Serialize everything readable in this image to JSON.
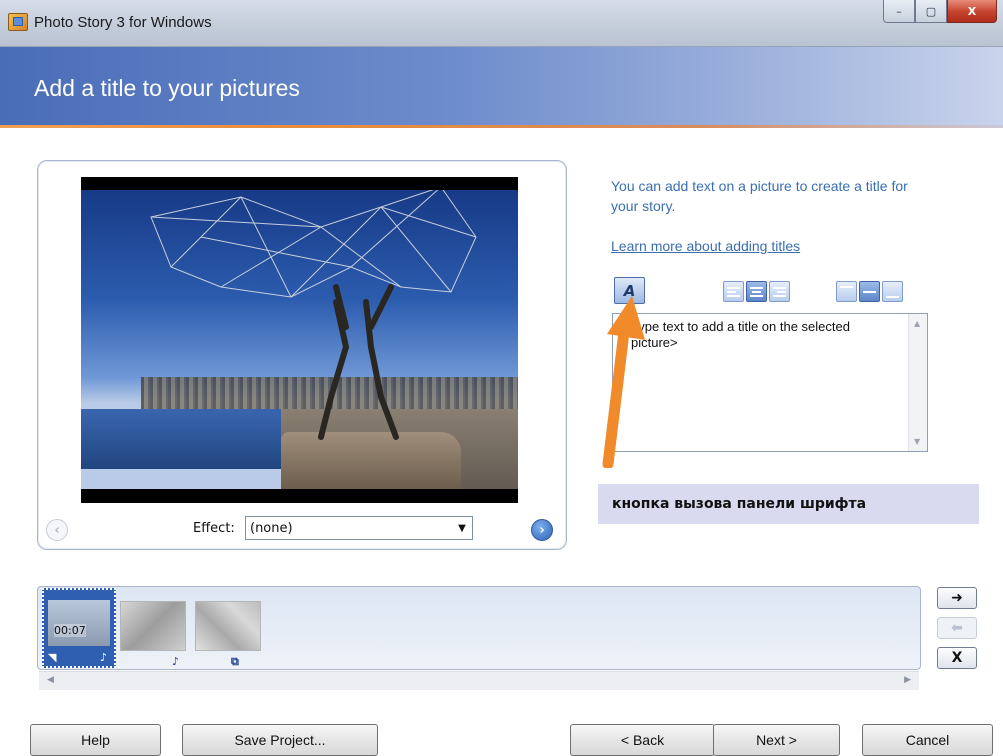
{
  "window": {
    "title": "Photo Story 3 for Windows",
    "minimize_label": "–",
    "maximize_label": "▢",
    "close_label": "X"
  },
  "header": {
    "title": "Add a title to your pictures"
  },
  "preview": {
    "effect_label": "Effect:",
    "effect_value": "(none)",
    "prev_glyph": "‹",
    "next_glyph": "›"
  },
  "title_panel": {
    "info_text": "You can add text on a picture to create a title for your story.",
    "learn_more_link": "Learn more about adding titles",
    "font_button_glyph": "A",
    "text_placeholder": "Type text to add a title on the selected picture>"
  },
  "annotation": {
    "text": "кнопка вызова панели шрифта",
    "accent_color": "#f08a2a"
  },
  "filmstrip": {
    "thumbs": [
      {
        "time": "00:07"
      },
      {
        "time": ""
      },
      {
        "time": ""
      }
    ],
    "move_right_glyph": "➜",
    "move_left_glyph": "⬅",
    "remove_glyph": "X"
  },
  "footer": {
    "help": "Help",
    "save_project": "Save Project...",
    "back": "< Back",
    "next": "Next >",
    "cancel": "Cancel"
  },
  "icons": [
    "app-icon",
    "font-icon",
    "align-left-icon",
    "align-center-icon",
    "align-right-icon",
    "position-top-icon",
    "position-middle-icon",
    "position-bottom-icon",
    "music-note-icon",
    "transition-icon",
    "arrow-right-icon",
    "arrow-left-icon",
    "delete-icon"
  ]
}
